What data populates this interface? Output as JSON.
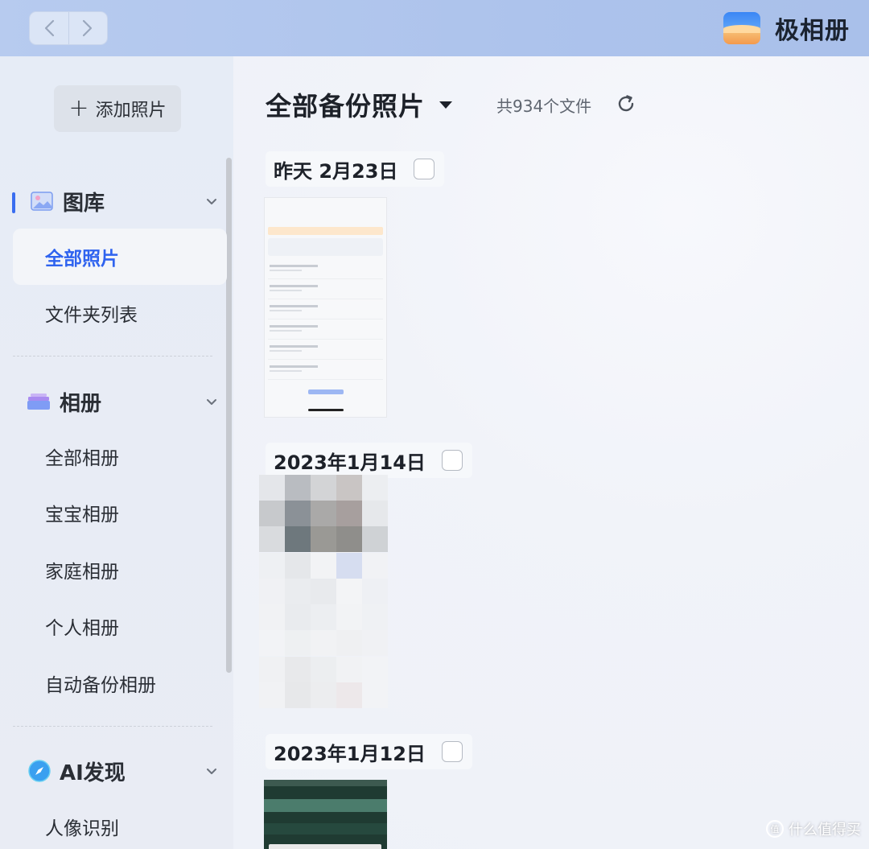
{
  "app": {
    "name": "极相册"
  },
  "sidebar": {
    "add_button": "添加照片",
    "sections": [
      {
        "label": "图库",
        "items": [
          "全部照片",
          "文件夹列表"
        ]
      },
      {
        "label": "相册",
        "items": [
          "全部相册",
          "宝宝相册",
          "家庭相册",
          "个人相册",
          "自动备份相册"
        ]
      },
      {
        "label": "AI发现",
        "items": [
          "人像识别"
        ]
      }
    ],
    "active_item": "全部照片"
  },
  "main": {
    "title": "全部备份照片",
    "file_count": "共934个文件",
    "groups": [
      {
        "date": "昨天 2月23日"
      },
      {
        "date": "2023年1月14日"
      },
      {
        "date": "2023年1月12日"
      }
    ]
  },
  "watermark": "什么值得买",
  "colors": {
    "accent": "#2f63ef",
    "topbar": "#b7cbef"
  }
}
